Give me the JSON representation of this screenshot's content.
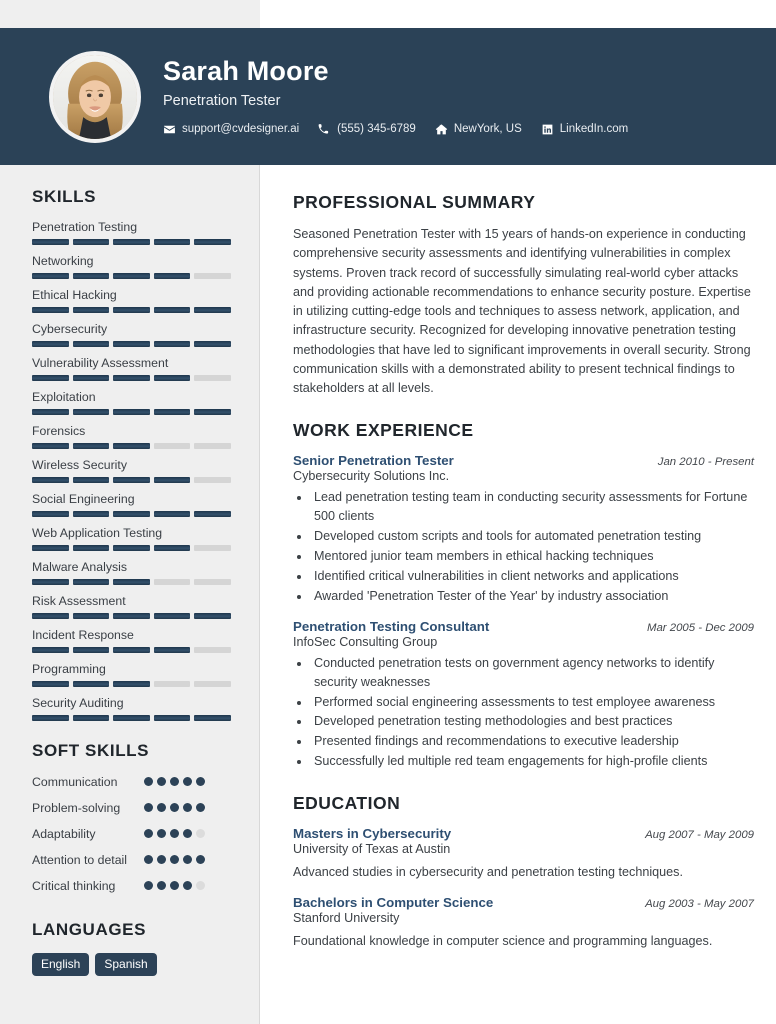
{
  "header": {
    "name": "Sarah Moore",
    "role": "Penetration Tester",
    "avatar_alt": "profile-photo",
    "contacts": [
      {
        "icon": "envelope-icon",
        "text": "support@cvdesigner.ai"
      },
      {
        "icon": "phone-icon",
        "text": "(555) 345-6789"
      },
      {
        "icon": "home-icon",
        "text": "NewYork, US"
      },
      {
        "icon": "linkedin-icon",
        "text": "LinkedIn.com"
      }
    ]
  },
  "sidebar": {
    "skills_heading": "SKILLS",
    "skills_max": 5,
    "skills": [
      {
        "label": "Penetration Testing",
        "level": 5
      },
      {
        "label": "Networking",
        "level": 4
      },
      {
        "label": "Ethical Hacking",
        "level": 5
      },
      {
        "label": "Cybersecurity",
        "level": 5
      },
      {
        "label": "Vulnerability Assessment",
        "level": 4
      },
      {
        "label": "Exploitation",
        "level": 5
      },
      {
        "label": "Forensics",
        "level": 3
      },
      {
        "label": "Wireless Security",
        "level": 4
      },
      {
        "label": "Social Engineering",
        "level": 5
      },
      {
        "label": "Web Application Testing",
        "level": 4
      },
      {
        "label": "Malware Analysis",
        "level": 3
      },
      {
        "label": "Risk Assessment",
        "level": 5
      },
      {
        "label": "Incident Response",
        "level": 4
      },
      {
        "label": "Programming",
        "level": 3
      },
      {
        "label": "Security Auditing",
        "level": 5
      }
    ],
    "soft_skills_heading": "SOFT SKILLS",
    "soft_max": 5,
    "soft_skills": [
      {
        "label": "Communication",
        "level": 5
      },
      {
        "label": "Problem-solving",
        "level": 5
      },
      {
        "label": "Adaptability",
        "level": 4
      },
      {
        "label": "Attention to detail",
        "level": 5
      },
      {
        "label": "Critical thinking",
        "level": 4
      }
    ],
    "languages_heading": "LANGUAGES",
    "languages": [
      "English",
      "Spanish"
    ]
  },
  "main": {
    "summary_heading": "PROFESSIONAL SUMMARY",
    "summary_text": "Seasoned Penetration Tester with 15 years of hands-on experience in conducting comprehensive security assessments and identifying vulnerabilities in complex systems. Proven track record of successfully simulating real-world cyber attacks and providing actionable recommendations to enhance security posture. Expertise in utilizing cutting-edge tools and techniques to assess network, application, and infrastructure security. Recognized for developing innovative penetration testing methodologies that have led to significant improvements in overall security. Strong communication skills with a demonstrated ability to present technical findings to stakeholders at all levels.",
    "experience_heading": "WORK EXPERIENCE",
    "experience": [
      {
        "title": "Senior Penetration Tester",
        "date": "Jan 2010 - Present",
        "org": "Cybersecurity Solutions Inc.",
        "bullets": [
          "Lead penetration testing team in conducting security assessments for Fortune 500 clients",
          "Developed custom scripts and tools for automated penetration testing",
          "Mentored junior team members in ethical hacking techniques",
          "Identified critical vulnerabilities in client networks and applications",
          "Awarded 'Penetration Tester of the Year' by industry association"
        ]
      },
      {
        "title": "Penetration Testing Consultant",
        "date": "Mar 2005 - Dec 2009",
        "org": "InfoSec Consulting Group",
        "bullets": [
          "Conducted penetration tests on government agency networks to identify security weaknesses",
          "Performed social engineering assessments to test employee awareness",
          "Developed penetration testing methodologies and best practices",
          "Presented findings and recommendations to executive leadership",
          "Successfully led multiple red team engagements for high-profile clients"
        ]
      }
    ],
    "education_heading": "EDUCATION",
    "education": [
      {
        "title": "Masters in Cybersecurity",
        "date": "Aug 2007 - May 2009",
        "org": "University of Texas at Austin",
        "desc": "Advanced studies in cybersecurity and penetration testing techniques."
      },
      {
        "title": "Bachelors in Computer Science",
        "date": "Aug 2003 - May 2007",
        "org": "Stanford University",
        "desc": "Foundational knowledge in computer science and programming languages."
      }
    ]
  },
  "colors": {
    "header_bg": "#2b4257",
    "sidebar_bg": "#efefef",
    "accent": "#2e4f72",
    "bar_on": "#21374b",
    "bar_off": "#d5d5d5"
  }
}
